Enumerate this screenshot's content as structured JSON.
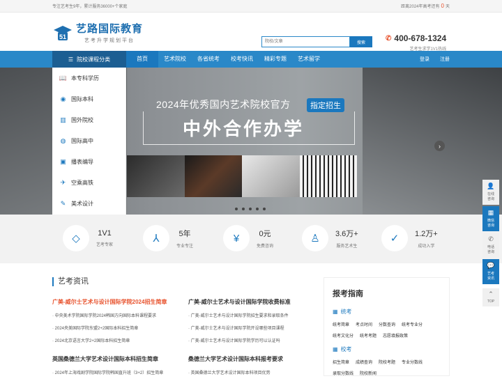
{
  "topbar": {
    "left": "专注艺考生9年，累计服务36000+个家庭",
    "countdown_prefix": "距离2024年高考还有",
    "countdown_days": "0",
    "countdown_suffix": "天"
  },
  "header": {
    "logo_title": "艺路国际教育",
    "logo_sub": "艺考升学规划平台",
    "search_placeholder": "院校/文章",
    "search_button": "搜索",
    "phone": "400-678-1324",
    "hotline": "艺考生求学1V1热线"
  },
  "nav": {
    "category": "院校课程分类",
    "links": [
      "首页",
      "艺术院校",
      "各省统考",
      "校考快讯",
      "精彩专题",
      "艺术留学"
    ],
    "login": "登录",
    "register": "注册"
  },
  "sidebar": [
    {
      "label": "本专科学历",
      "icon": "book-icon"
    },
    {
      "label": "国际本科",
      "icon": "location-pin-icon"
    },
    {
      "label": "国外院校",
      "icon": "building-icon"
    },
    {
      "label": "国际高中",
      "icon": "globe-icon"
    },
    {
      "label": "播表编导",
      "icon": "video-icon"
    },
    {
      "label": "空乘高铁",
      "icon": "plane-icon"
    },
    {
      "label": "美术设计",
      "icon": "palette-icon"
    }
  ],
  "banner": {
    "line1": "2024年优秀国内艺术院校官方",
    "tag": "指定招生",
    "line2": "中外合作办学"
  },
  "stats": [
    {
      "value": "1V1",
      "label": "艺考专家",
      "icon": "diamond-icon"
    },
    {
      "value": "5年",
      "label": "专业专注",
      "icon": "split-icon"
    },
    {
      "value": "0元",
      "label": "免费咨询",
      "icon": "yen-icon"
    },
    {
      "value": "3.6万+",
      "label": "服务艺术生",
      "icon": "person-icon"
    },
    {
      "value": "1.2万+",
      "label": "成功入学",
      "icon": "check-icon"
    }
  ],
  "news": {
    "title": "艺考资讯",
    "col1_head": "广美-威尔士艺术与设计国际学院2024招生简章",
    "col1_items": [
      "中央美术学院国际学院2024韩国方向国际本科课程要求",
      "2024央美国际学院东盟2+2国际本科招生简章",
      "2024北京语言大学2+2国际本科招生简章"
    ],
    "col2_head": "广美-威尔士艺术与设计国际学院收费标准",
    "col2_items": [
      "广美-威尔士艺术与设计国际学院招生要求和录取条件",
      "广美-威尔士艺术与设计国际学院开设哪些项目课程",
      "广美-威尔士艺术与设计国际学院学历可以认证吗"
    ],
    "col1_head2": "英国桑德兰大学艺术设计国际本科招生简章",
    "col1_item2": "2024年上海戏剧学院国际学院韩国直升班（3+2）招生简章",
    "col2_head2": "桑德兰大学艺术设计国际本科报考要求",
    "col2_item2": "英国桑德兰大学艺术设计国际本科项目优势"
  },
  "guide": {
    "title": "报考指南",
    "sec1": "统考",
    "sec1_links": [
      "统考简章",
      "考点时间",
      "分数查询",
      "统考专业分",
      "统考文化分",
      "统考考题",
      "志愿填报政策"
    ],
    "sec2": "校考",
    "sec2_links": [
      "招生简章",
      "成绩查询",
      "院校考题",
      "专业分数线",
      "录取分数线",
      "院校新闻"
    ]
  },
  "float": [
    {
      "label1": "在线",
      "label2": "咨询",
      "icon": "user-icon"
    },
    {
      "label1": "微信",
      "label2": "咨询",
      "icon": "qrcode-icon"
    },
    {
      "label1": "电话",
      "label2": "咨询",
      "icon": "phone-icon"
    },
    {
      "label1": "艺考",
      "label2": "资讯",
      "icon": "chat-icon"
    }
  ],
  "top": "TOP"
}
